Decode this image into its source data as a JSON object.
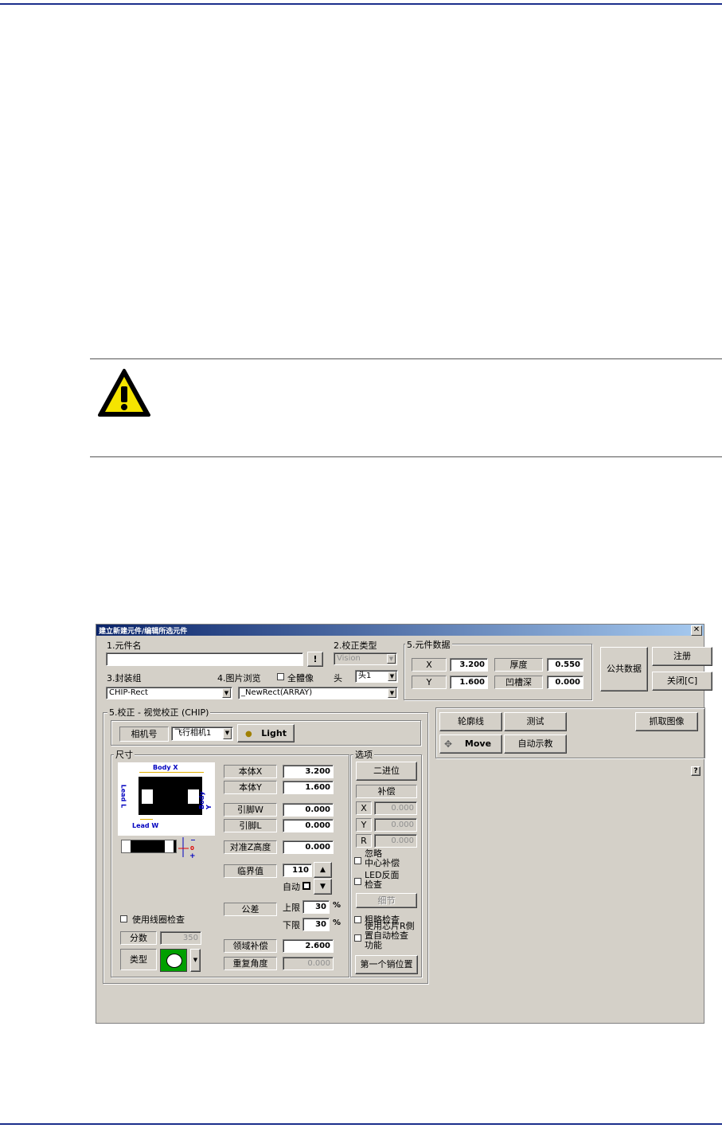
{
  "dialog": {
    "title": "建立新建元件/编辑所选元件",
    "close_symbol": "✕",
    "component_name": {
      "label": "1.元件名",
      "value": "",
      "button": "!"
    },
    "calib_type": {
      "label": "2.校正类型",
      "value": "Vision"
    },
    "package_group": {
      "label": "3.封装组",
      "value": "CHIP-Rect"
    },
    "image_browse": {
      "label": "4.图片浏览",
      "value": "_NewRect(ARRAY)",
      "full_image_label": "全體像",
      "head_label": "头",
      "head_value": "头1"
    },
    "component_data": {
      "title": "5.元件数据",
      "x_label": "X",
      "x_value": "3.200",
      "y_label": "Y",
      "y_value": "1.600",
      "thickness_label": "厚度",
      "thickness_value": "0.550",
      "groove_label": "凹槽深",
      "groove_value": "0.000"
    },
    "buttons": {
      "common_data": "公共数据",
      "register": "注册",
      "close": "关闭[C]"
    },
    "vision": {
      "title": "5.校正 - 视觉校正 (CHIP)",
      "camera_label": "相机号",
      "camera_value": "飞行相机1",
      "light_button": "Light",
      "size_title": "尺寸",
      "diagram": {
        "body_x": "Body X",
        "body_y": "Body Y",
        "lead_l": "Lead L",
        "lead_w": "Lead W"
      },
      "body_x_label": "本体X",
      "body_x_value": "3.200",
      "body_y_label": "本体Y",
      "body_y_value": "1.600",
      "lead_w_label": "引脚W",
      "lead_w_value": "0.000",
      "lead_l_label": "引脚L",
      "lead_l_value": "0.000",
      "align_z_label": "对准Z高度",
      "align_z_value": "0.000",
      "threshold_label": "临界值",
      "threshold_value": "110",
      "auto_label": "自动",
      "tolerance_label": "公差",
      "upper_label": "上限",
      "upper_value": "30",
      "lower_label": "下限",
      "lower_value": "30",
      "percent": "%",
      "coil_check_label": "使用线圈检查",
      "score_label": "分数",
      "score_value": "350",
      "type_label": "类型",
      "area_comp_label": "领域补偿",
      "area_comp_value": "2.600",
      "repeat_angle_label": "重复角度",
      "repeat_angle_value": "0.000",
      "options_title": "选项",
      "binary_button": "二进位",
      "comp_label": "补偿",
      "comp_x_label": "X",
      "comp_x_value": "0.000",
      "comp_y_label": "Y",
      "comp_y_value": "0.000",
      "comp_r_label": "R",
      "comp_r_value": "0.000",
      "ignore_center_label": "忽略\n中心补偿",
      "led_reverse_label": "LED反面\n检查",
      "detail_button": "细节",
      "coarse_check_label": "粗略检查",
      "chip_r_side_label": "使用芯片R側\n置自动检查\n功能",
      "first_pin_button": "第一个销位置"
    },
    "right_panel": {
      "outline": "轮廓线",
      "test": "测试",
      "capture": "抓取图像",
      "move": "Move",
      "auto_teach": "自动示教",
      "help": "?"
    }
  }
}
